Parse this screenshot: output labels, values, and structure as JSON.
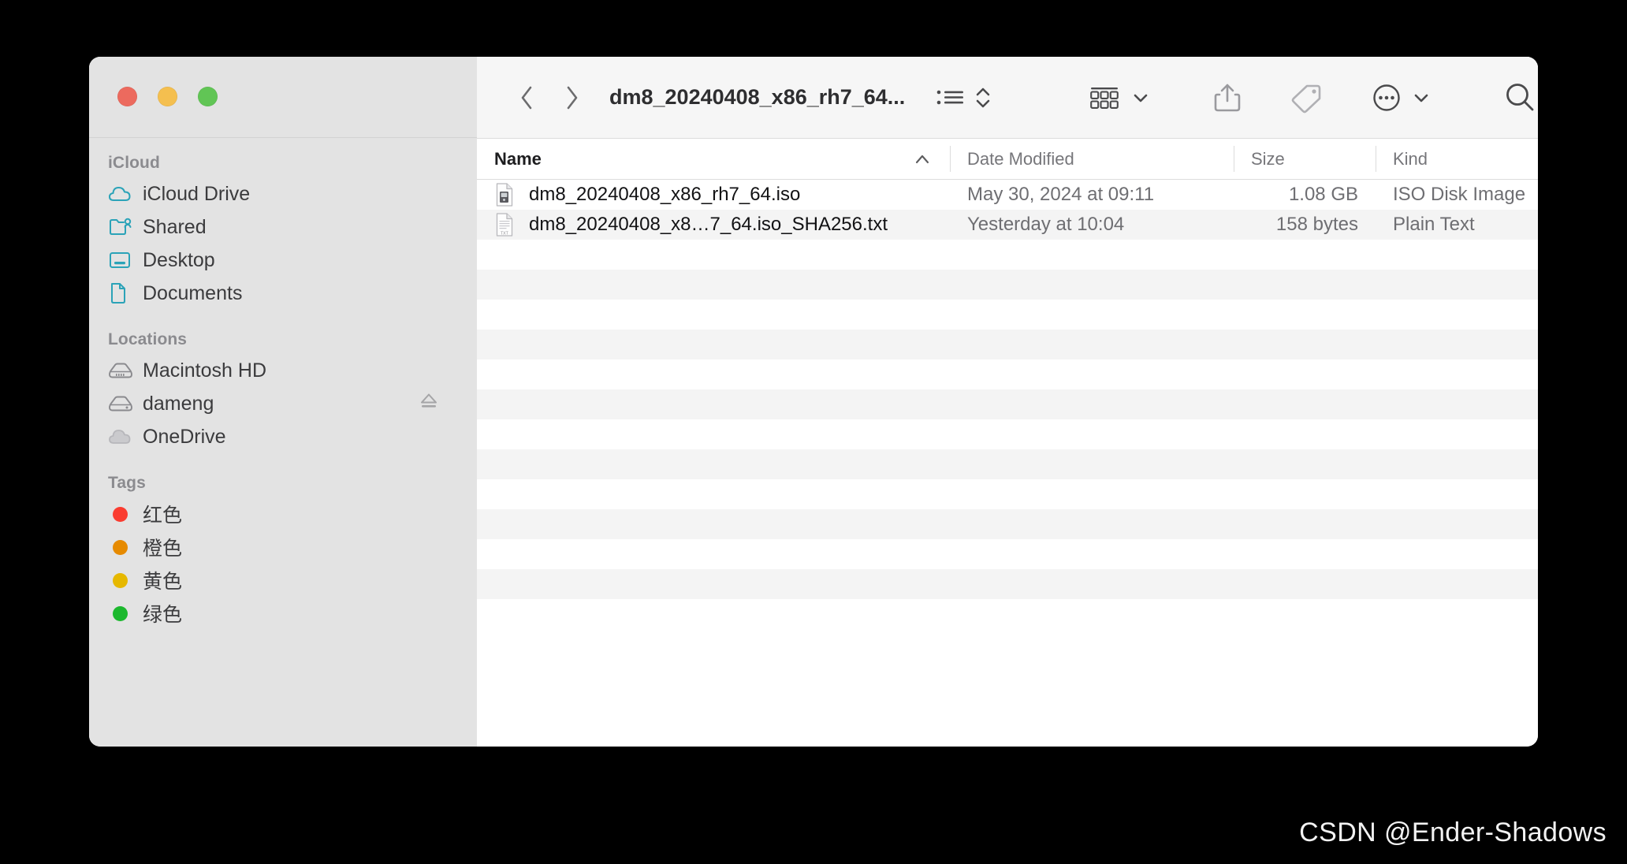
{
  "window": {
    "traffic_lights": [
      {
        "name": "close",
        "color": "#ec6a5e"
      },
      {
        "name": "minimize",
        "color": "#f4bf4f"
      },
      {
        "name": "zoom",
        "color": "#61c555"
      }
    ]
  },
  "toolbar": {
    "back_icon": "chevron-left-icon",
    "forward_icon": "chevron-right-icon",
    "title": "dm8_20240408_x86_rh7_64...",
    "view_list_icon": "list-view-icon",
    "sort_icon": "sort-updown-icon",
    "group_icon": "group-by-icon",
    "group_chevron_icon": "chevron-down-icon",
    "share_icon": "share-icon",
    "tag_icon": "tag-icon",
    "more_icon": "more-ellipsis-icon",
    "more_chevron_icon": "chevron-down-icon",
    "search_icon": "search-icon"
  },
  "sidebar": {
    "groups": [
      {
        "title": "iCloud",
        "items": [
          {
            "label": "iCloud Drive",
            "icon": "cloud-icon",
            "color": "#2ba3b8",
            "eject": false
          },
          {
            "label": "Shared",
            "icon": "shared-folder-icon",
            "color": "#2ba3b8",
            "eject": false
          },
          {
            "label": "Desktop",
            "icon": "desktop-icon",
            "color": "#2ba3b8",
            "eject": false
          },
          {
            "label": "Documents",
            "icon": "document-icon",
            "color": "#2ba3b8",
            "eject": false
          }
        ]
      },
      {
        "title": "Locations",
        "items": [
          {
            "label": "Macintosh HD",
            "icon": "internal-drive-icon",
            "color": "#8a8a8e",
            "eject": false
          },
          {
            "label": "dameng",
            "icon": "external-drive-icon",
            "color": "#8a8a8e",
            "eject": true
          },
          {
            "label": "OneDrive",
            "icon": "cloud-filled-icon",
            "color": "#b7b7bb",
            "eject": false
          }
        ]
      },
      {
        "title": "Tags",
        "items": [
          {
            "label": "红色",
            "icon": "tag-dot-icon",
            "color": "#fa3c30",
            "eject": false
          },
          {
            "label": "橙色",
            "icon": "tag-dot-icon",
            "color": "#e68a00",
            "eject": false
          },
          {
            "label": "黄色",
            "icon": "tag-dot-icon",
            "color": "#e6b800",
            "eject": false
          },
          {
            "label": "绿色",
            "icon": "tag-dot-icon",
            "color": "#1cb82e",
            "eject": false
          }
        ]
      }
    ]
  },
  "file_list": {
    "columns": [
      {
        "key": "name",
        "label": "Name",
        "sorted": true,
        "sort_direction": "ascending"
      },
      {
        "key": "date",
        "label": "Date Modified",
        "sorted": false,
        "sort_direction": ""
      },
      {
        "key": "size",
        "label": "Size",
        "sorted": false,
        "sort_direction": ""
      },
      {
        "key": "kind",
        "label": "Kind",
        "sorted": false,
        "sort_direction": ""
      }
    ],
    "rows": [
      {
        "name": "dm8_20240408_x86_rh7_64.iso",
        "date": "May 30, 2024 at 09:11",
        "size": "1.08 GB",
        "kind": "ISO Disk Image",
        "icon": "iso-disk-image-icon"
      },
      {
        "name": "dm8_20240408_x8…7_64.iso_SHA256.txt",
        "date": "Yesterday at 10:04",
        "size": "158 bytes",
        "kind": "Plain Text",
        "icon": "plain-text-file-icon"
      }
    ],
    "empty_row_count": 12
  },
  "watermark": {
    "text": "CSDN @Ender-Shadows"
  }
}
